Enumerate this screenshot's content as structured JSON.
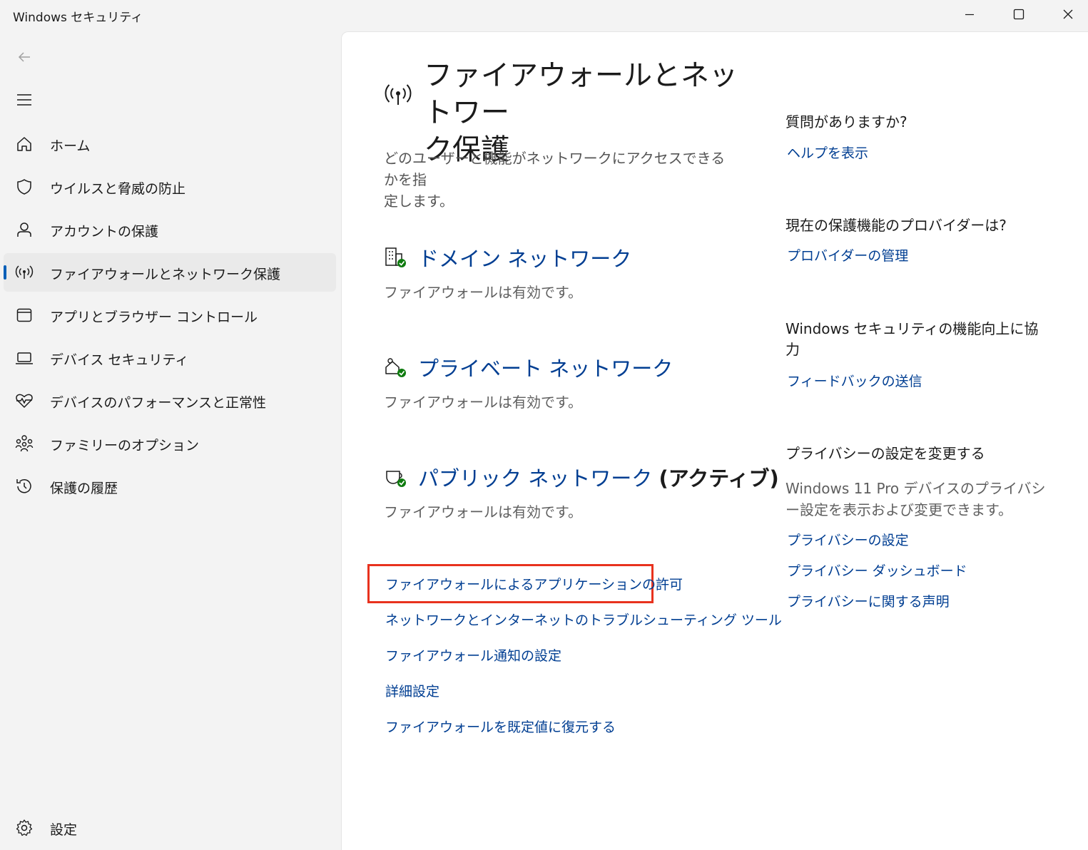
{
  "window": {
    "title": "Windows セキュリティ"
  },
  "sidebar": {
    "back_icon": "back-arrow-icon",
    "menu_icon": "hamburger-menu-icon",
    "items": [
      {
        "label": "ホーム",
        "icon": "home-icon",
        "active": false
      },
      {
        "label": "ウイルスと脅威の防止",
        "icon": "shield-icon",
        "active": false
      },
      {
        "label": "アカウントの保護",
        "icon": "person-icon",
        "active": false
      },
      {
        "label": "ファイアウォールとネットワーク保護",
        "icon": "wifi-antenna-icon",
        "active": true
      },
      {
        "label": "アプリとブラウザー コントロール",
        "icon": "app-window-icon",
        "active": false
      },
      {
        "label": "デバイス セキュリティ",
        "icon": "laptop-icon",
        "active": false
      },
      {
        "label": "デバイスのパフォーマンスと正常性",
        "icon": "heart-pulse-icon",
        "active": false
      },
      {
        "label": "ファミリーのオプション",
        "icon": "family-icon",
        "active": false
      },
      {
        "label": "保護の履歴",
        "icon": "history-icon",
        "active": false
      }
    ],
    "settings_label": "設定"
  },
  "main": {
    "title": "ファイアウォールとネットワーク保護",
    "title_line1": "ファイアウォールとネットワー",
    "title_line2": "ク保護",
    "description": "どのユーザーと機能がネットワークにアクセスできるかを指定します。",
    "description_line1": "どのユーザーと機能がネットワークにアクセスできるかを指",
    "description_line2": "定します。",
    "networks": [
      {
        "name": "ドメイン ネットワーク",
        "suffix": "",
        "status": "ファイアウォールは有効です。",
        "icon": "domain-network-icon"
      },
      {
        "name": "プライベート ネットワーク",
        "suffix": "",
        "status": "ファイアウォールは有効です。",
        "icon": "private-network-icon"
      },
      {
        "name": "パブリック ネットワーク",
        "suffix": "(アクティブ)",
        "status": "ファイアウォールは有効です。",
        "icon": "public-network-icon"
      }
    ],
    "links": [
      "ファイアウォールによるアプリケーションの許可",
      "ネットワークとインターネットのトラブルシューティング ツール",
      "ファイアウォール通知の設定",
      "詳細設定",
      "ファイアウォールを既定値に復元する"
    ],
    "highlight_color": "#e8321e"
  },
  "right": {
    "help": {
      "heading": "質問がありますか?",
      "link": "ヘルプを表示"
    },
    "provider": {
      "heading": "現在の保護機能のプロバイダーは?",
      "link": "プロバイダーの管理"
    },
    "feedback": {
      "heading": "Windows セキュリティの機能向上に協力",
      "link": "フィードバックの送信"
    },
    "privacy": {
      "heading": "プライバシーの設定を変更する",
      "text": "Windows 11 Pro デバイスのプライバシー設定を表示および変更できます。",
      "links": [
        "プライバシーの設定",
        "プライバシー ダッシュボード",
        "プライバシーに関する声明"
      ]
    }
  },
  "colors": {
    "accent": "#005fb8",
    "link": "#003e92",
    "status_ok": "#0f7b0f"
  }
}
